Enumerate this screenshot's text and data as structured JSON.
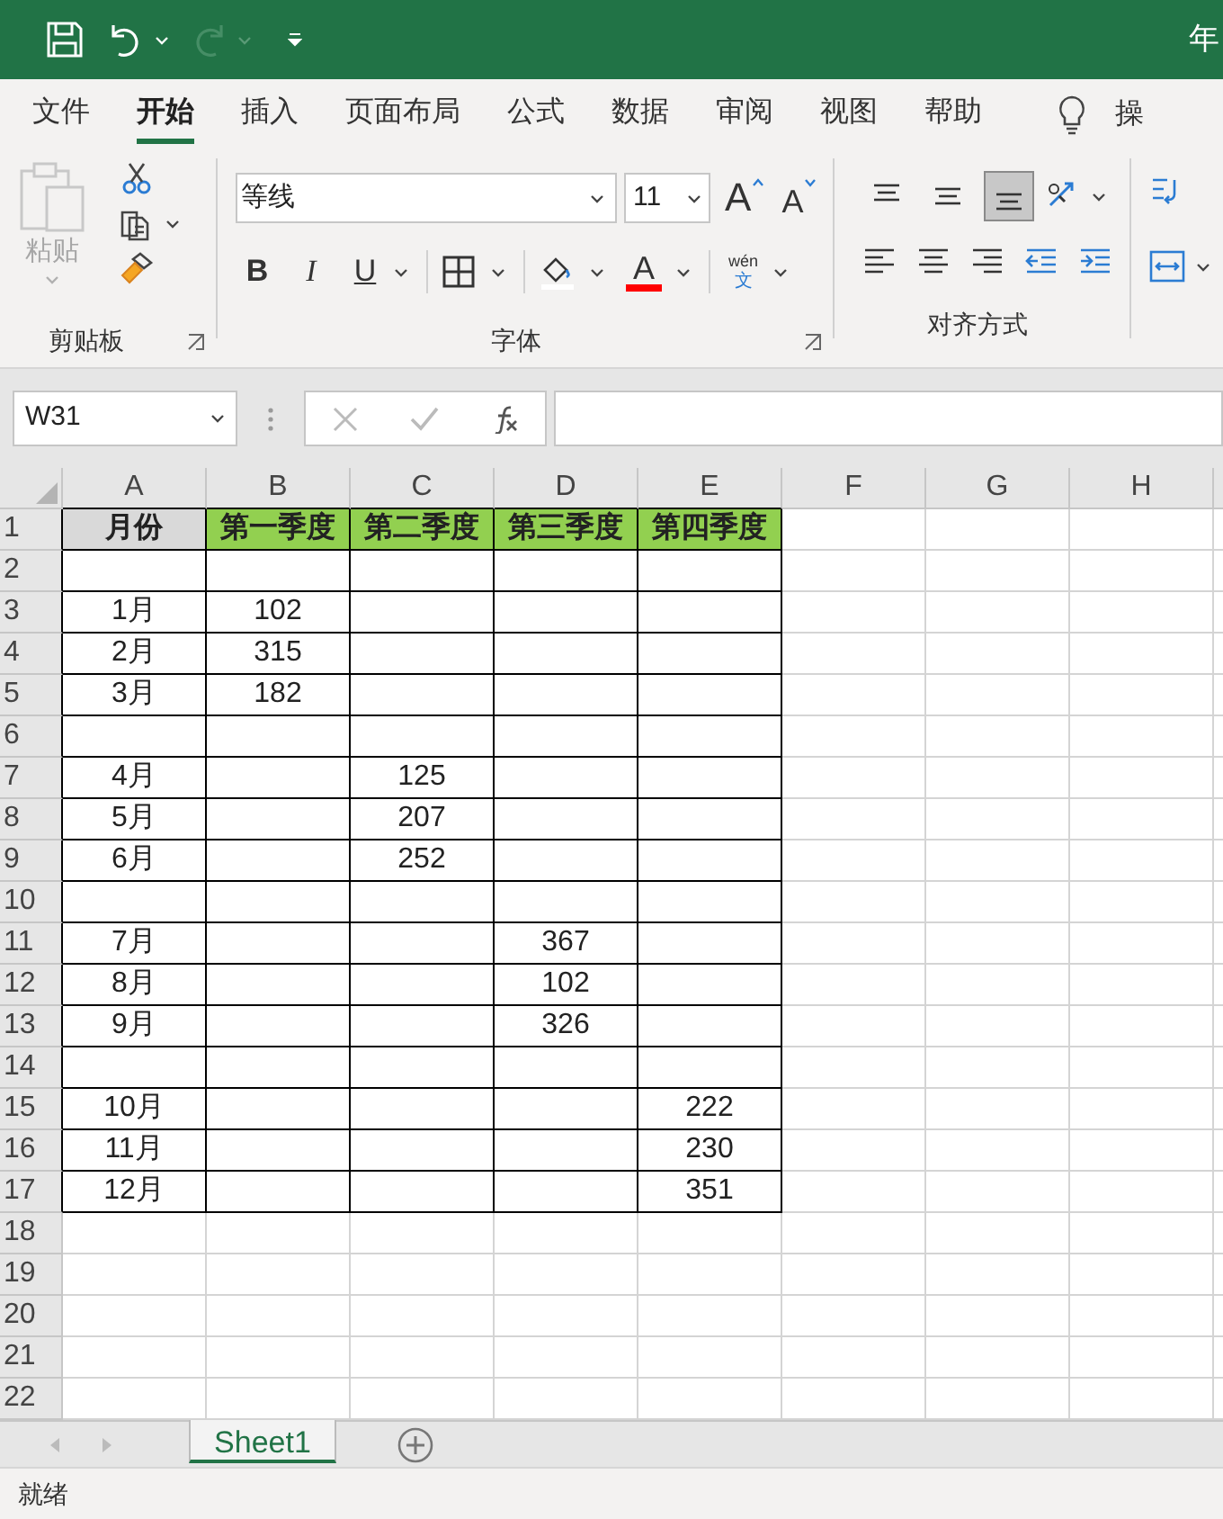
{
  "title_bar": {
    "title": "年",
    "redo_disabled": true
  },
  "menu_tabs": [
    {
      "label": "文件",
      "selected": false
    },
    {
      "label": "开始",
      "selected": true
    },
    {
      "label": "插入",
      "selected": false
    },
    {
      "label": "页面布局",
      "selected": false
    },
    {
      "label": "公式",
      "selected": false
    },
    {
      "label": "数据",
      "selected": false
    },
    {
      "label": "审阅",
      "selected": false
    },
    {
      "label": "视图",
      "selected": false
    },
    {
      "label": "帮助",
      "selected": false
    }
  ],
  "tell_me": {
    "label": "操"
  },
  "ribbon": {
    "clipboard": {
      "paste_label": "粘贴",
      "paste_disabled": true,
      "group_label": "剪贴板"
    },
    "font": {
      "font_name": "等线",
      "font_size": "11",
      "grow_label": "A",
      "shrink_label": "A",
      "bold_label": "B",
      "italic_label": "I",
      "underline_label": "U",
      "font_color_label": "A",
      "phonetic_top": "wén",
      "phonetic_bottom": "文",
      "group_label": "字体"
    },
    "alignment": {
      "group_label": "对齐方式",
      "vertical": [
        {
          "kind": "top",
          "selected": false
        },
        {
          "kind": "middle",
          "selected": false
        },
        {
          "kind": "bottom",
          "selected": true
        }
      ]
    }
  },
  "formula_bar": {
    "name_box": "W31"
  },
  "sheet": {
    "columns": [
      {
        "label": "A",
        "bordered": true
      },
      {
        "label": "B",
        "bordered": true
      },
      {
        "label": "C",
        "bordered": true
      },
      {
        "label": "D",
        "bordered": true
      },
      {
        "label": "E",
        "bordered": true
      },
      {
        "label": "F"
      },
      {
        "label": "G"
      },
      {
        "label": "H"
      }
    ],
    "rows": [
      {
        "header": "1",
        "bordered": true,
        "cells": {
          "A": {
            "text": "月份",
            "bold": true,
            "color": "#d9d9d9"
          },
          "B": {
            "text": "第一季度",
            "bold": true,
            "color": "#92d050"
          },
          "C": {
            "text": "第二季度",
            "bold": true,
            "color": "#92d050"
          },
          "D": {
            "text": "第三季度",
            "bold": true,
            "color": "#92d050"
          },
          "E": {
            "text": "第四季度",
            "bold": true,
            "color": "#92d050"
          }
        }
      },
      {
        "header": "2",
        "bordered": true,
        "cells": {}
      },
      {
        "header": "3",
        "bordered": true,
        "cells": {
          "A": {
            "text": "1月"
          },
          "B": {
            "text": "102"
          }
        }
      },
      {
        "header": "4",
        "bordered": true,
        "cells": {
          "A": {
            "text": "2月"
          },
          "B": {
            "text": "315"
          }
        }
      },
      {
        "header": "5",
        "bordered": true,
        "cells": {
          "A": {
            "text": "3月"
          },
          "B": {
            "text": "182"
          }
        }
      },
      {
        "header": "6",
        "bordered": true,
        "cells": {}
      },
      {
        "header": "7",
        "bordered": true,
        "cells": {
          "A": {
            "text": "4月"
          },
          "C": {
            "text": "125"
          }
        }
      },
      {
        "header": "8",
        "bordered": true,
        "cells": {
          "A": {
            "text": "5月"
          },
          "C": {
            "text": "207"
          }
        }
      },
      {
        "header": "9",
        "bordered": true,
        "cells": {
          "A": {
            "text": "6月"
          },
          "C": {
            "text": "252"
          }
        }
      },
      {
        "header": "10",
        "bordered": true,
        "cells": {}
      },
      {
        "header": "11",
        "bordered": true,
        "cells": {
          "A": {
            "text": "7月"
          },
          "D": {
            "text": "367"
          }
        }
      },
      {
        "header": "12",
        "bordered": true,
        "cells": {
          "A": {
            "text": "8月"
          },
          "D": {
            "text": "102"
          }
        }
      },
      {
        "header": "13",
        "bordered": true,
        "cells": {
          "A": {
            "text": "9月"
          },
          "D": {
            "text": "326"
          }
        }
      },
      {
        "header": "14",
        "bordered": true,
        "cells": {}
      },
      {
        "header": "15",
        "bordered": true,
        "cells": {
          "A": {
            "text": "10月"
          },
          "E": {
            "text": "222"
          }
        }
      },
      {
        "header": "16",
        "bordered": true,
        "cells": {
          "A": {
            "text": "11月"
          },
          "E": {
            "text": "230"
          }
        }
      },
      {
        "header": "17",
        "bordered": true,
        "cells": {
          "A": {
            "text": "12月"
          },
          "E": {
            "text": "351"
          }
        }
      },
      {
        "header": "18",
        "bordered": false,
        "cells": {}
      },
      {
        "header": "19",
        "bordered": false,
        "cells": {}
      },
      {
        "header": "20",
        "bordered": false,
        "cells": {}
      },
      {
        "header": "21",
        "bordered": false,
        "cells": {}
      },
      {
        "header": "22",
        "bordered": false,
        "cells": {}
      }
    ]
  },
  "sheet_tabs": [
    {
      "label": "Sheet1",
      "selected": true
    }
  ],
  "status_bar": {
    "text": "就绪"
  }
}
